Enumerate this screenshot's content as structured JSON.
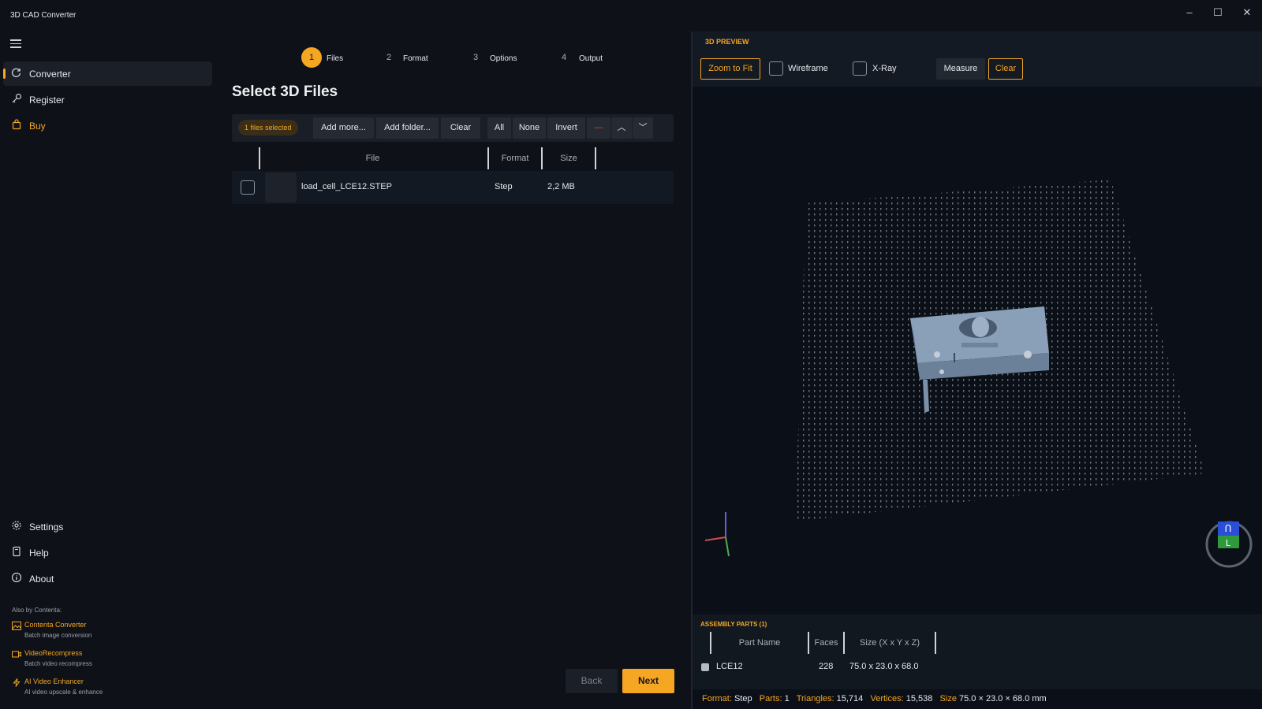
{
  "app": {
    "title": "3D CAD Converter"
  },
  "window_controls": {
    "minimize": "–",
    "maximize": "☐",
    "close": "✕"
  },
  "sidebar": {
    "nav": [
      {
        "label": "Converter",
        "icon": "converter-icon",
        "active": true
      },
      {
        "label": "Register",
        "icon": "key-icon"
      },
      {
        "label": "Buy",
        "icon": "shopping-bag-icon"
      }
    ],
    "bottom_nav": [
      {
        "label": "Settings",
        "icon": "gear-icon"
      },
      {
        "label": "Help",
        "icon": "book-icon"
      },
      {
        "label": "About",
        "icon": "info-icon"
      }
    ],
    "also_by": "Also by Contenta:",
    "promos": [
      {
        "name": "Contenta Converter",
        "sub": "Batch image conversion",
        "icon": "image-icon"
      },
      {
        "name": "VideoRecompress",
        "sub": "Batch video recompress",
        "icon": "video-icon"
      },
      {
        "name": "AI Video Enhancer",
        "sub": "AI video upscale & enhance",
        "icon": "lightning-icon"
      }
    ]
  },
  "steps": [
    {
      "num": "1",
      "label": "Files",
      "active": true
    },
    {
      "num": "2",
      "label": "Format"
    },
    {
      "num": "3",
      "label": "Options"
    },
    {
      "num": "4",
      "label": "Output"
    }
  ],
  "page_title": "Select 3D Files",
  "toolbar": {
    "selected_badge": "1 files selected",
    "add_more": "Add more...",
    "add_folder": "Add folder...",
    "clear": "Clear",
    "all": "All",
    "none": "None",
    "invert": "Invert",
    "remove": "—",
    "up": "︿",
    "down": "﹀"
  },
  "file_table": {
    "headers": {
      "file": "File",
      "format": "Format",
      "size": "Size"
    },
    "rows": [
      {
        "file": "load_cell_LCE12.STEP",
        "format": "Step",
        "size": "2,2 MB"
      }
    ]
  },
  "footer": {
    "back": "Back",
    "next": "Next"
  },
  "preview": {
    "title": "3D PREVIEW",
    "zoom_to_fit": "Zoom to Fit",
    "wireframe": "Wireframe",
    "xray": "X-Ray",
    "measure": "Measure",
    "clear": "Clear",
    "view_cube": {
      "top_face": "Ո",
      "front_face": "L"
    }
  },
  "assembly": {
    "title": "ASSEMBLY PARTS  (1)",
    "headers": {
      "part_name": "Part Name",
      "faces": "Faces",
      "size": "Size (X x Y x Z)"
    },
    "rows": [
      {
        "name": "LCE12",
        "faces": "228",
        "size": "75.0  x  23.0  x  68.0"
      }
    ]
  },
  "status": {
    "format_key": "Format:",
    "format_val": "Step",
    "parts_key": "Parts:",
    "parts_val": "1",
    "triangles_key": "Triangles:",
    "triangles_val": "15,714",
    "vertices_key": "Vertices:",
    "vertices_val": "15,538",
    "size_key": "Size",
    "size_val": "75.0 × 23.0 × 68.0 mm"
  },
  "colors": {
    "accent": "#f5a623",
    "background": "#0e1117",
    "model": "#7d93ad"
  }
}
